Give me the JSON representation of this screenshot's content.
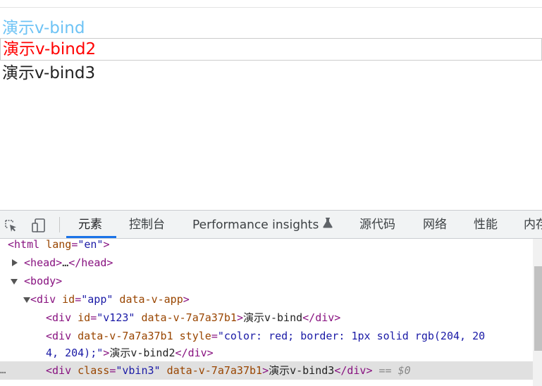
{
  "page": {
    "line1": {
      "text": "演示v-bind",
      "color": "#6ec3f5"
    },
    "line2": {
      "text": "演示v-bind2",
      "color": "#ff0000",
      "border_color": "#cccccc"
    },
    "line3": {
      "text": "演示v-bind3",
      "color": "#222222"
    }
  },
  "devtools": {
    "toolbar": {
      "inspect_icon": "inspect-element-icon",
      "device_icon": "device-toolbar-icon",
      "tabs": [
        "元素",
        "控制台",
        "Performance insights",
        "源代码",
        "网络",
        "性能",
        "内存"
      ],
      "active_tab": "元素",
      "experiment_icon": "beaker-icon",
      "accent_color": "#1a73e8"
    },
    "dom": {
      "html_open": {
        "tag": "<html",
        "attr": " lang",
        "eq": "=",
        "val": "\"en\"",
        "end": ">"
      },
      "head": {
        "open": "<head>",
        "ellipsis": "…",
        "close": "</head>"
      },
      "body": "<body>",
      "app_div": {
        "tag": "<div",
        "attr1": " id",
        "eq": "=",
        "val1": "\"app\"",
        "attr2": " data-v-app",
        "end": ">"
      },
      "div1": {
        "tag": "<div",
        "attr1": " id",
        "eq": "=",
        "val1": "\"v123\"",
        "attr2": " data-v-7a7a37b1",
        "end": ">",
        "text": "演示v-bind",
        "close": "</div>"
      },
      "div2_a": {
        "tag": "<div",
        "attr1": " data-v-7a7a37b1",
        "attr2": " style",
        "eq": "=",
        "val": "\"color: red; border: 1px solid rgb(204, 20"
      },
      "div2_b": {
        "val": "4, 204);\"",
        "end": ">",
        "text": "演示v-bind2",
        "close": "</div>"
      },
      "div3": {
        "tag": "<div",
        "attr1": " class",
        "eq": "=",
        "val1": "\"vbin3\"",
        "attr2": " data-v-7a7a37b1",
        "end": ">",
        "text": "演示v-bind3",
        "close": "</div>",
        "marker": " == $0"
      },
      "row_dots": "…"
    }
  }
}
